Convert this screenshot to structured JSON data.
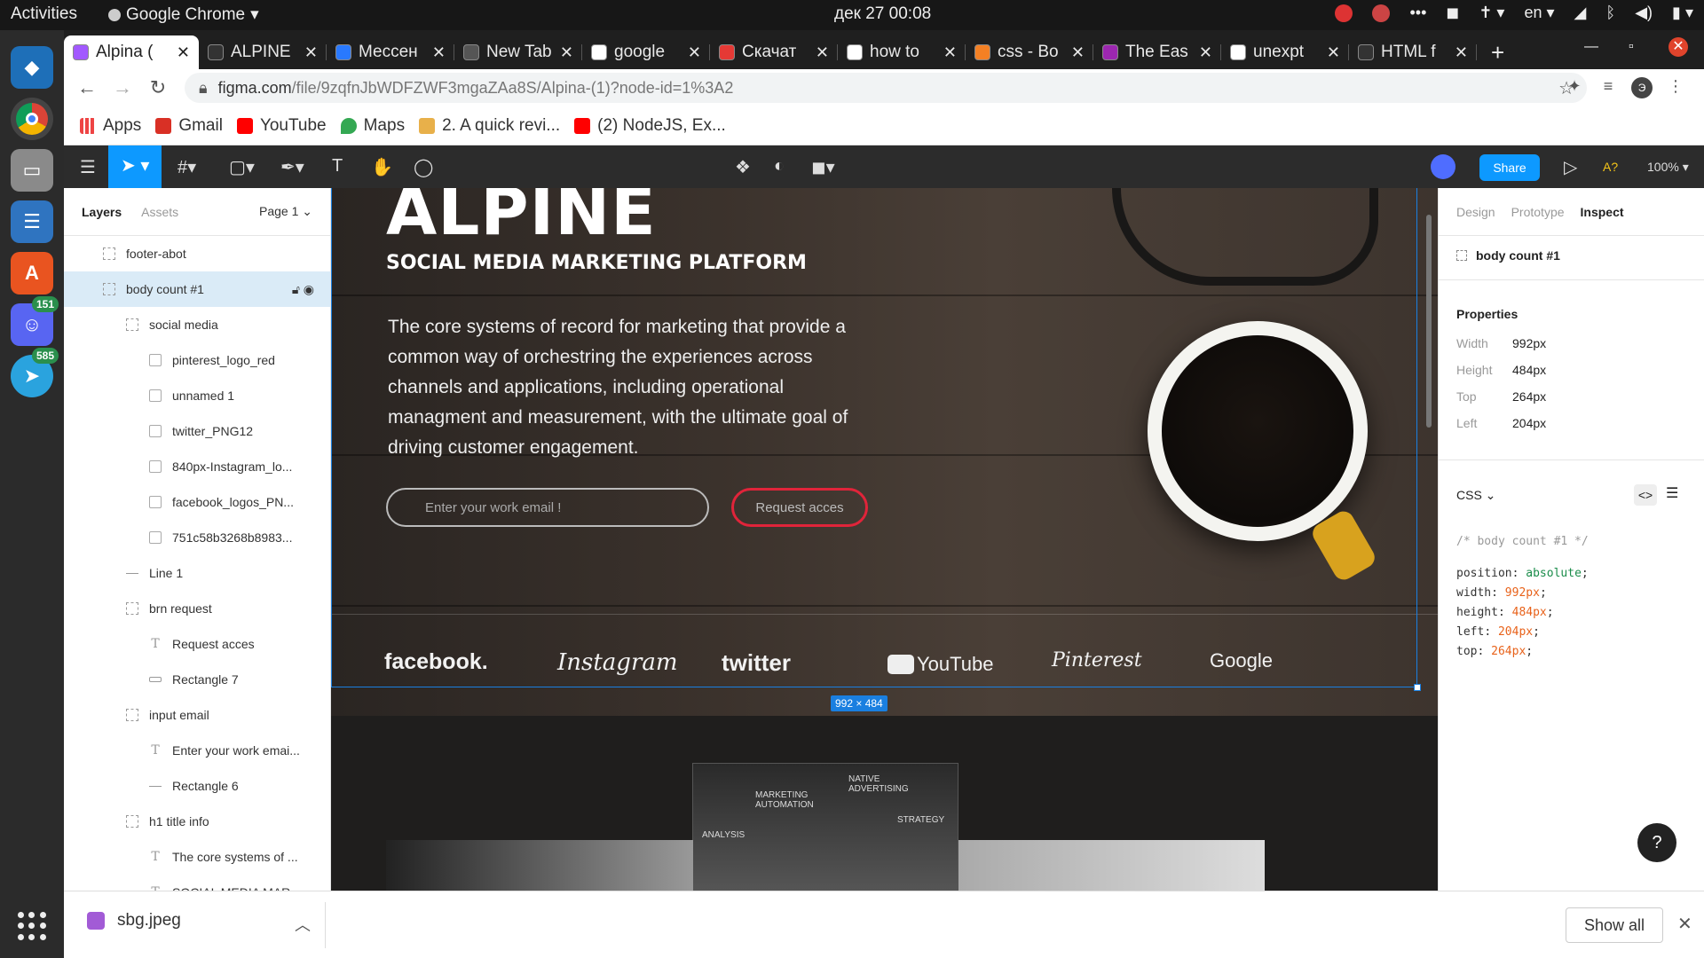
{
  "os": {
    "activities": "Activities",
    "app_name": "Google Chrome",
    "clock": "дек 27  00:08",
    "lang": "en",
    "dock_badges": [
      "151",
      "585"
    ]
  },
  "tabs": [
    {
      "label": "Alpina (",
      "active": true
    },
    {
      "label": "ALPINE"
    },
    {
      "label": "Мессен"
    },
    {
      "label": "New Tab"
    },
    {
      "label": "google"
    },
    {
      "label": "Скачат"
    },
    {
      "label": "how to"
    },
    {
      "label": "css - Bo"
    },
    {
      "label": "The Eas"
    },
    {
      "label": "unexpt"
    },
    {
      "label": "HTML f"
    }
  ],
  "url": {
    "host": "figma.com",
    "path": "/file/9zqfnJbWDFZWF3mgaZAa8S/Alpina-(1)?node-id=1%3A2"
  },
  "profile_letter": "Э",
  "bookmarks": [
    "Apps",
    "Gmail",
    "YouTube",
    "Maps",
    "2. A quick revi...",
    "(2) NodeJS, Ex..."
  ],
  "toolbar": {
    "share": "Share",
    "a11y": "A?",
    "zoom": "100%"
  },
  "left_panel": {
    "tab_layers": "Layers",
    "tab_assets": "Assets",
    "page": "Page 1",
    "layers": [
      {
        "name": "footer-abot",
        "type": "frame",
        "indent": 1
      },
      {
        "name": "body count #1",
        "type": "frame",
        "indent": 1,
        "selected": true
      },
      {
        "name": "social media",
        "type": "frame",
        "indent": 2
      },
      {
        "name": "pinterest_logo_red",
        "type": "img",
        "indent": 3
      },
      {
        "name": "unnamed 1",
        "type": "img",
        "indent": 3
      },
      {
        "name": "twitter_PNG12",
        "type": "img",
        "indent": 3
      },
      {
        "name": "840px-Instagram_lo...",
        "type": "img",
        "indent": 3
      },
      {
        "name": "facebook_logos_PN...",
        "type": "img",
        "indent": 3
      },
      {
        "name": "751c58b3268b8983...",
        "type": "img",
        "indent": 3
      },
      {
        "name": "Line 1",
        "type": "line",
        "indent": 2
      },
      {
        "name": "brn request",
        "type": "frame",
        "indent": 2
      },
      {
        "name": "Request acces",
        "type": "txt",
        "indent": 3
      },
      {
        "name": "Rectangle 7",
        "type": "rect",
        "indent": 3
      },
      {
        "name": "input email",
        "type": "frame",
        "indent": 2
      },
      {
        "name": "Enter your work emai...",
        "type": "txt",
        "indent": 3
      },
      {
        "name": "Rectangle 6",
        "type": "line",
        "indent": 3
      },
      {
        "name": "h1 title info",
        "type": "frame",
        "indent": 2
      },
      {
        "name": "The core systems of ...",
        "type": "txt",
        "indent": 3
      },
      {
        "name": "SOCIAL MEDIA MAR...",
        "type": "txt",
        "indent": 3
      }
    ]
  },
  "canvas": {
    "title": "ALPINE",
    "subtitle": "SOCIAL MEDIA MARKETING PLATFORM",
    "description": "The core systems of record for marketing that provide a common way of orchestring the experiences across channels and applications, including operational managment and measurement, with the ultimate goal of driving customer engagement.",
    "email_placeholder": "Enter your work email !",
    "request_button": "Request acces",
    "logos": [
      "facebook.",
      "Instagram",
      "twitter",
      "YouTube",
      "Pinterest",
      "Google"
    ],
    "size_tag": "992 × 484",
    "photo_labels": [
      "MARKETING AUTOMATION",
      "NATIVE ADVERTISING",
      "ANALYSIS",
      "STRATEGY"
    ]
  },
  "right_panel": {
    "tabs": [
      "Design",
      "Prototype",
      "Inspect"
    ],
    "active_tab": "Inspect",
    "layer_name": "body count #1",
    "properties_title": "Properties",
    "properties": [
      {
        "label": "Width",
        "value": "992px"
      },
      {
        "label": "Height",
        "value": "484px"
      },
      {
        "label": "Top",
        "value": "264px"
      },
      {
        "label": "Left",
        "value": "204px"
      }
    ],
    "css_label": "CSS",
    "code_comment": "/* body count #1 */",
    "code": [
      {
        "prop": "position",
        "val": "absolute",
        "kind": "kw"
      },
      {
        "prop": "width",
        "val": "992px",
        "kind": "num"
      },
      {
        "prop": "height",
        "val": "484px",
        "kind": "num"
      },
      {
        "prop": "left",
        "val": "204px",
        "kind": "num"
      },
      {
        "prop": "top",
        "val": "264px",
        "kind": "num"
      }
    ]
  },
  "download": {
    "file": "sbg.jpeg",
    "show_all": "Show all"
  },
  "colors": {
    "figma_blue": "#0d99ff",
    "request_red": "#e0243a",
    "selection": "#1a7fe0"
  }
}
